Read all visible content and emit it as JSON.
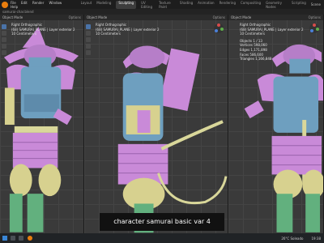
{
  "app": {
    "menu": [
      "File",
      "Edit",
      "Render",
      "Window",
      "Help"
    ],
    "workspaces": [
      "Layout",
      "Modeling",
      "Sculpting",
      "UV Editing",
      "Texture Paint",
      "Shading",
      "Animation",
      "Rendering",
      "Compositing",
      "Geometry Nodes",
      "Scripting"
    ],
    "active_workspace": "Sculpting",
    "scene": "Scene",
    "file_title": "samurai-char.blend"
  },
  "viewports": [
    {
      "header": "Object Mode",
      "options": "Options",
      "overlay": [
        "Right Orthographic",
        "(68) SAMURAI_PLANE | Layer exterior 2",
        "10 Centimeters"
      ],
      "stats": []
    },
    {
      "header": "Object Mode",
      "options": "Options",
      "overlay": [
        "Right Orthographic",
        "(68) SAMURAI_PLANE | Layer exterior 2",
        "10 Centimeters"
      ],
      "stats": []
    },
    {
      "header": "Object Mode",
      "options": "Options",
      "overlay": [
        "Right Orthographic",
        "(68) SAMURAI_PLANE | Layer exterior 2",
        "10 Centimeters"
      ],
      "stats": [
        "Objects  1 / 13",
        "Vertices  598,060",
        "Edges  1,171,898",
        "Faces  586,600",
        "Triangles  1,166,848"
      ]
    }
  ],
  "caption": "character samurai basic var 4",
  "taskbar": {
    "weather": "26°C  Soleado",
    "time": "19:38"
  },
  "colors": {
    "armor_pink": "#c98ad8",
    "armor_blue": "#6e9fbf",
    "armor_green": "#62b07e",
    "rope_yellow": "#d9d79a",
    "skin_yellow": "#d7d18f"
  }
}
